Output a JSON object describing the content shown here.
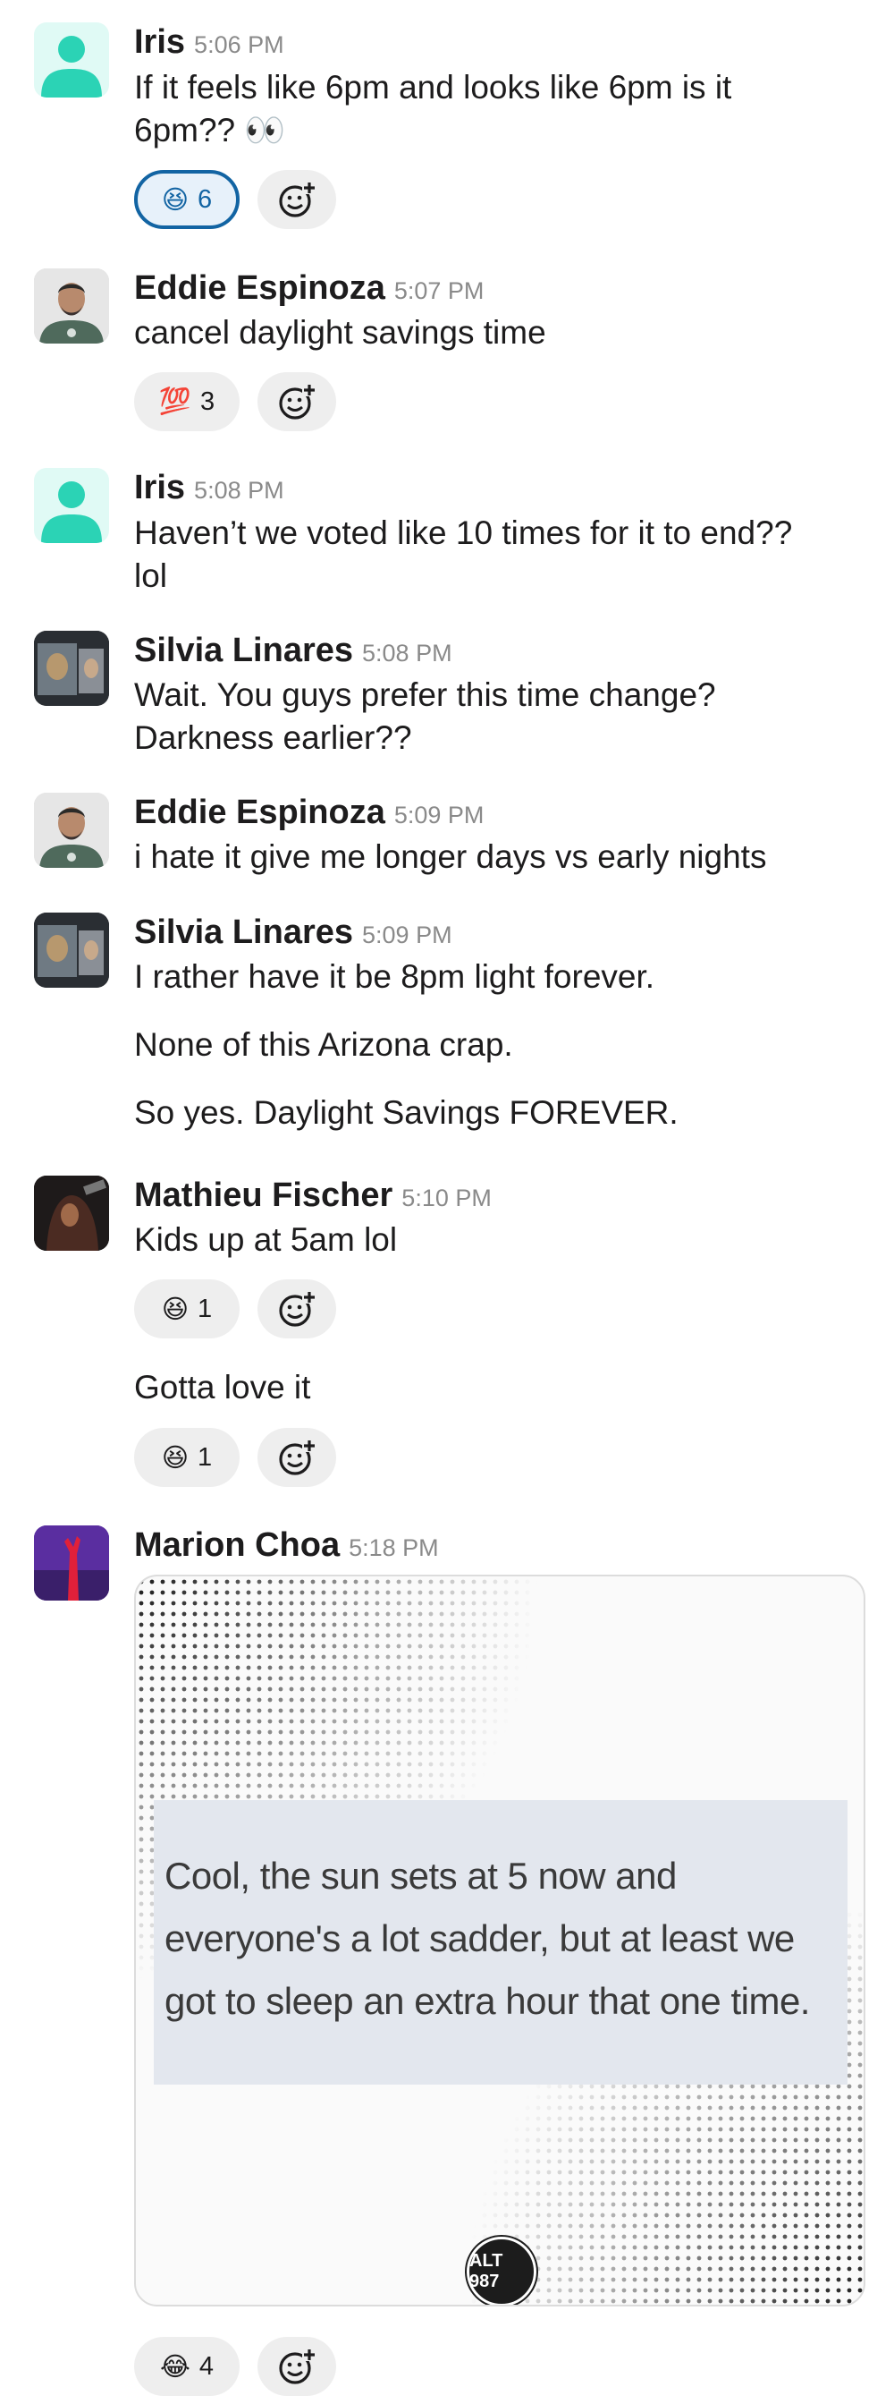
{
  "messages": [
    {
      "author": "Iris",
      "time": "5:06 PM",
      "lines": [
        "If it feels like 6pm and looks like 6pm is it",
        "6pm?? 👀"
      ],
      "reactions": [
        {
          "emoji": "😆",
          "count": "6",
          "mine": true
        }
      ]
    },
    {
      "author": "Eddie Espinoza",
      "time": "5:07 PM",
      "lines": [
        "cancel daylight savings time"
      ],
      "reactions": [
        {
          "emoji": "💯",
          "count": "3"
        }
      ]
    },
    {
      "author": "Iris",
      "time": "5:08 PM",
      "lines": [
        "Haven’t we voted like 10 times for it to end??",
        "lol"
      ]
    },
    {
      "author": "Silvia Linares",
      "time": "5:08 PM",
      "lines": [
        "Wait. You guys prefer this time change?",
        "Darkness earlier??"
      ]
    },
    {
      "author": "Eddie Espinoza",
      "time": "5:09 PM",
      "lines": [
        "i hate it give me longer days vs early nights"
      ]
    },
    {
      "author": "Silvia Linares",
      "time": "5:09 PM",
      "lines": [
        "I rather have it be 8pm light forever.",
        "None of this Arizona crap.",
        "So yes. Daylight Savings FOREVER."
      ]
    },
    {
      "author": "Mathieu Fischer",
      "time": "5:10 PM",
      "lines": [
        "Kids up at 5am lol",
        "Gotta love it"
      ],
      "reactions": [
        {
          "emoji": "😆",
          "count": "1"
        },
        {
          "emoji": "😆",
          "count": "1"
        }
      ]
    },
    {
      "author": "Marion Choa",
      "time": "5:18 PM",
      "image_text_lines": [
        "Cool, the sun sets at 5 now and",
        "everyone's a lot sadder, but at least we",
        "got to sleep an extra hour that one time."
      ],
      "image_logo": "ALT 987",
      "reactions": [
        {
          "emoji": "😂",
          "count": "4"
        }
      ]
    }
  ],
  "icons": {
    "add_reaction": "add-reaction-icon",
    "default_avatar": "user-silhouette-icon"
  },
  "colors": {
    "reaction_selected_border": "#1264a3",
    "default_avatar_bg": "#e0faf5",
    "default_avatar_fg": "#2bd3b5"
  }
}
